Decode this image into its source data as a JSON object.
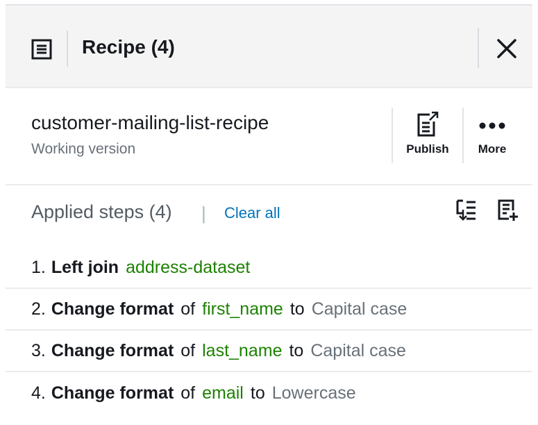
{
  "header": {
    "title": "Recipe (4)",
    "icon": "recipe-list-icon",
    "close_icon": "close-icon"
  },
  "recipe": {
    "name": "customer-mailing-list-recipe",
    "version": "Working version",
    "actions": {
      "publish_label": "Publish",
      "more_label": "More"
    }
  },
  "steps_section": {
    "title": "Applied steps (4)",
    "divider": "|",
    "clear_all": "Clear all",
    "icons": [
      "download-steps-icon",
      "import-steps-icon"
    ]
  },
  "steps": [
    {
      "number": "1.",
      "action": "Left join",
      "column": "address-dataset",
      "connector": "",
      "value": ""
    },
    {
      "number": "2.",
      "action": "Change format",
      "of": "of",
      "column": "first_name",
      "connector": "to",
      "value": "Capital case"
    },
    {
      "number": "3.",
      "action": "Change format",
      "of": "of",
      "column": "last_name",
      "connector": "to",
      "value": "Capital case"
    },
    {
      "number": "4.",
      "action": "Change format",
      "of": "of",
      "column": "email",
      "connector": "to",
      "value": "Lowercase"
    }
  ],
  "colors": {
    "link": "#0073bb",
    "column": "#1d8102",
    "muted": "#687078",
    "header_bg": "#f4f4f4"
  }
}
